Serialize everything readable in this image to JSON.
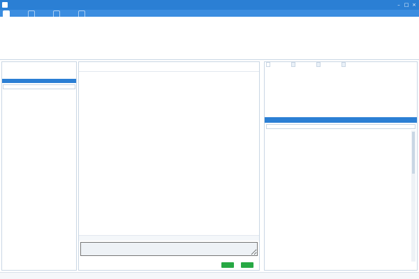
{
  "window": {
    "title": "",
    "version": "",
    "buttons": [
      "",
      ""
    ],
    "settings_label": ""
  },
  "menu": {
    "tabs": [
      "",
      "",
      "",
      ""
    ]
  },
  "toolbar": {
    "items": [
      "",
      "",
      "",
      "",
      "",
      "",
      "",
      ""
    ]
  },
  "left_pane": {
    "box_labels": [
      "",
      ""
    ],
    "counts_label": "",
    "search_placeholder": ""
  },
  "chat": {
    "header_left": "",
    "header_actions": [
      "",
      ""
    ],
    "send_labels": [
      "",
      ""
    ]
  },
  "info": {
    "tabs": [
      "",
      "",
      "",
      ""
    ],
    "fields": [
      {
        "label": "",
        "value": ""
      },
      {
        "label": "",
        "value": ""
      },
      {
        "label": "",
        "value": ""
      },
      {
        "label": "",
        "value": ""
      },
      {
        "label": "",
        "value": ""
      },
      {
        "label": "",
        "value": ""
      },
      {
        "label": "",
        "value": ""
      },
      {
        "label": "",
        "value": ""
      },
      {
        "label": "",
        "value": ""
      },
      {
        "label": "",
        "value": ""
      },
      {
        "label": "",
        "value": ""
      },
      {
        "label": "",
        "value": ""
      },
      {
        "label": "",
        "value": ""
      },
      {
        "label": "",
        "value": ""
      }
    ]
  },
  "scripts": {
    "tabs": [
      "",
      ""
    ],
    "search_placeholder": "",
    "rows": [
      "",
      "",
      "",
      "",
      "",
      "",
      "",
      "",
      "",
      "",
      "",
      "",
      "",
      "",
      "",
      "",
      "",
      "",
      "",
      "",
      ""
    ],
    "bottom_buttons": [
      "",
      "",
      ""
    ]
  },
  "status": {
    "build": "",
    "role": "",
    "time": ""
  },
  "colors": {
    "primary": "#2b7fd4",
    "menu": "#3b8de0",
    "accent_red": "#e02222",
    "send_green": "#27a844"
  }
}
